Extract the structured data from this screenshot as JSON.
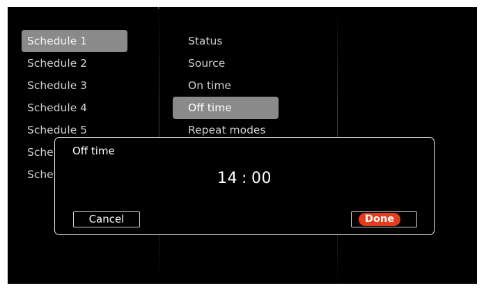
{
  "schedules": [
    {
      "label": "Schedule 1",
      "selected": true
    },
    {
      "label": "Schedule 2",
      "selected": false
    },
    {
      "label": "Schedule 3",
      "selected": false
    },
    {
      "label": "Schedule 4",
      "selected": false
    },
    {
      "label": "Schedule 5",
      "selected": false
    },
    {
      "label": "Sche",
      "selected": false
    },
    {
      "label": "Sche",
      "selected": false
    }
  ],
  "settings": [
    {
      "label": "Status",
      "selected": false
    },
    {
      "label": "Source",
      "selected": false
    },
    {
      "label": "On time",
      "selected": false
    },
    {
      "label": "Off time",
      "selected": true
    },
    {
      "label": "Repeat modes",
      "selected": false
    }
  ],
  "dialog": {
    "title": "Off time",
    "hour": "14",
    "separator": ":",
    "minute": "00",
    "cancel_label": "Cancel",
    "done_label": "Done"
  },
  "colors": {
    "selection": "#8a8a8a",
    "done_accent": "#e63c1e",
    "background": "#000000"
  }
}
